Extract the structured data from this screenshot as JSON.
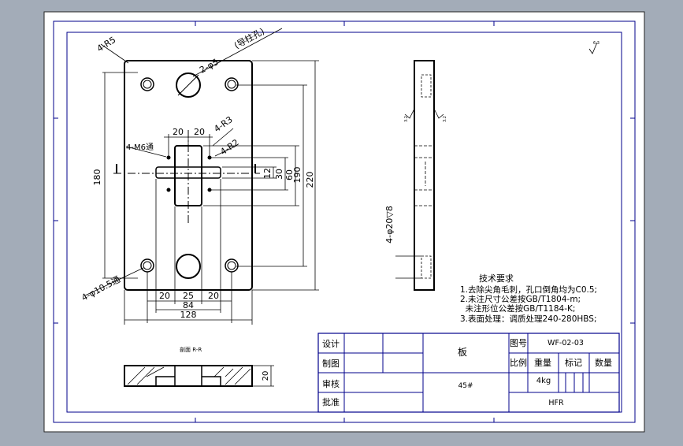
{
  "dimensions": {
    "corner_radius": "4-R5",
    "pin_hole": "2-φ5",
    "pin_hole_note": "(导柱孔)",
    "slot_radius": "4-R3",
    "small_radius": "4-R2",
    "through_hole": "4-M6通",
    "through_hole_2": "4-φ10.5通",
    "overall_height": "220",
    "height_190": "190",
    "height_180": "180",
    "height_60": "60",
    "height_30": "30",
    "height_12": "12",
    "width_128": "128",
    "width_84": "84",
    "dim_20_a": "20",
    "dim_20_b": "20",
    "dim_20_c": "20",
    "dim_25": "25",
    "dim_20_d": "20",
    "side_hole": "4-φ20▽8",
    "section_thickness": "20"
  },
  "roughness": {
    "top_right": "6.3",
    "side_a": "3.2",
    "side_b": "3.2"
  },
  "section_label": "剖面 R-R",
  "tech_req": {
    "heading": "技术要求",
    "lines": [
      "1.去除尖角毛刺，孔口倒角均为C0.5;",
      "2.未注尺寸公差按GB/T1804-m;",
      "  未注形位公差按GB/T1184-K;",
      "3.表面处理：调质处理240-280HBS;"
    ]
  },
  "title_block": {
    "design": "设计",
    "drafting": "制图",
    "review": "审核",
    "approve": "批准",
    "part_name": "板",
    "material": "45#",
    "drawing_no_label": "图号",
    "drawing_no": "WF-02-03",
    "scale_label": "比例",
    "weight_label": "重量",
    "mark_label": "标记",
    "quantity_label": "数量",
    "weight": "4kg",
    "company": "HFR"
  }
}
